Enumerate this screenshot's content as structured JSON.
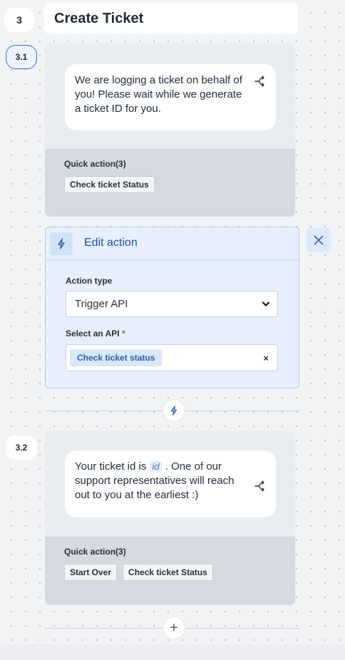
{
  "step": {
    "number": "3",
    "title": "Create Ticket"
  },
  "nodes": [
    {
      "id": "3.1",
      "message": "We are logging a ticket on behalf of you! Please wait while we generate a ticket ID for you.",
      "quick_action_label": "Quick action(3)",
      "quick_actions": [
        "Check ticket Status"
      ]
    },
    {
      "id": "3.2",
      "message_before": "Your ticket id is",
      "variable": "id",
      "message_after": ". One of our support representatives will reach out to you at the earliest :)",
      "quick_action_label": "Quick action(3)",
      "quick_actions": [
        "Start Over",
        "Check ticket Status"
      ]
    }
  ],
  "edit_action": {
    "title": "Edit action",
    "action_type_label": "Action type",
    "action_type_value": "Trigger API",
    "api_label": "Select an API",
    "required_mark": "*",
    "api_value": "Check ticket status",
    "clear_symbol": "×"
  },
  "icons": {
    "branch": "branch-icon",
    "bolt": "bolt-icon",
    "close": "close-icon",
    "chevron": "chevron-down-icon",
    "add": "plus-icon"
  },
  "add_symbol": "+",
  "colors": {
    "accent": "#1c4f96",
    "panel": "#e5f0fc",
    "card": "#e8ebef"
  }
}
